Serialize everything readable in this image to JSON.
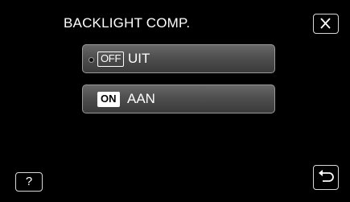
{
  "screen": {
    "title": "BACKLIGHT COMP."
  },
  "options": [
    {
      "badge": "OFF",
      "label": "UIT",
      "selected": true
    },
    {
      "badge": "ON",
      "label": "AAN",
      "selected": false
    }
  ],
  "buttons": {
    "close_icon": "close-x-icon",
    "help_label": "?",
    "back_icon": "return-arrow-icon"
  }
}
